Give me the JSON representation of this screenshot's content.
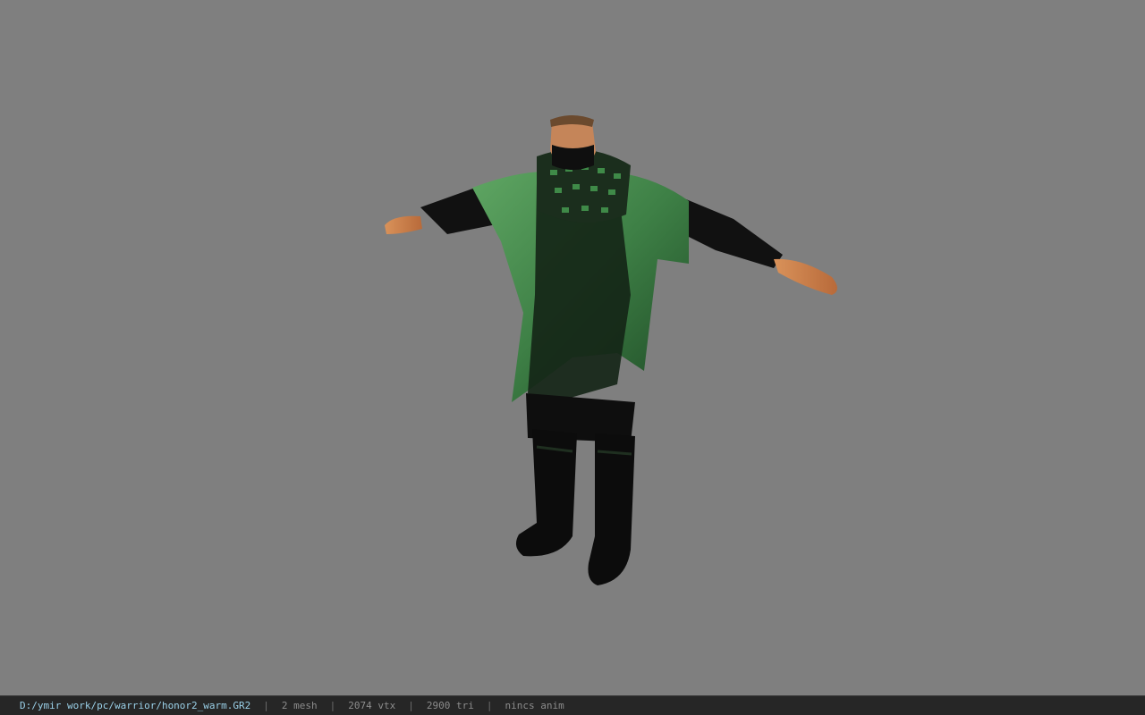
{
  "viewer": {
    "background_color": "#7f7f7f",
    "model_icon": "character-model-t-pose"
  },
  "statusbar": {
    "path": "D:/ymir work/pc/warrior/honor2_warm.GR2",
    "separator": "|",
    "mesh_count": "2 mesh",
    "vertex_count": "2074 vtx",
    "triangle_count": "2900 tri",
    "anim": "nincs anim"
  }
}
